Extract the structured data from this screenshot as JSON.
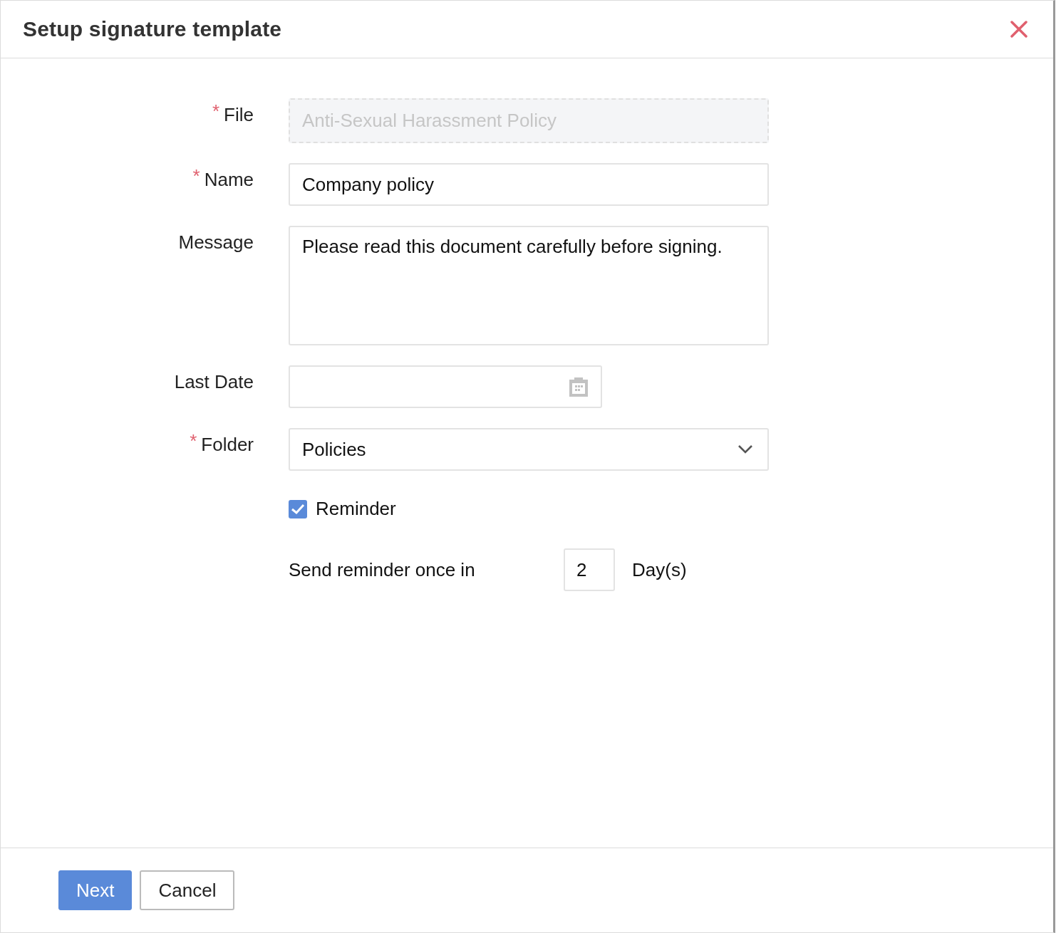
{
  "dialog": {
    "title": "Setup signature template"
  },
  "required_mark": "*",
  "fields": [
    {
      "kind": "file",
      "label": "File",
      "required": true,
      "value": "Anti-Sexual Harassment Policy",
      "disabled": true
    },
    {
      "kind": "text",
      "label": "Name",
      "required": true,
      "value": "Company policy"
    },
    {
      "kind": "textarea",
      "label": "Message",
      "required": false,
      "value": "Please read this document carefully before signing."
    },
    {
      "kind": "date",
      "label": "Last Date",
      "required": false
    },
    {
      "kind": "select",
      "label": "Folder",
      "required": true,
      "value": "Policies"
    }
  ],
  "reminder": {
    "label": "Reminder",
    "checked": true,
    "prefix": "Send reminder once in",
    "value": "2",
    "suffix": "Day(s)"
  },
  "buttons": [
    {
      "kind": "primary",
      "label": "Next"
    },
    {
      "kind": "secondary",
      "label": "Cancel"
    }
  ]
}
